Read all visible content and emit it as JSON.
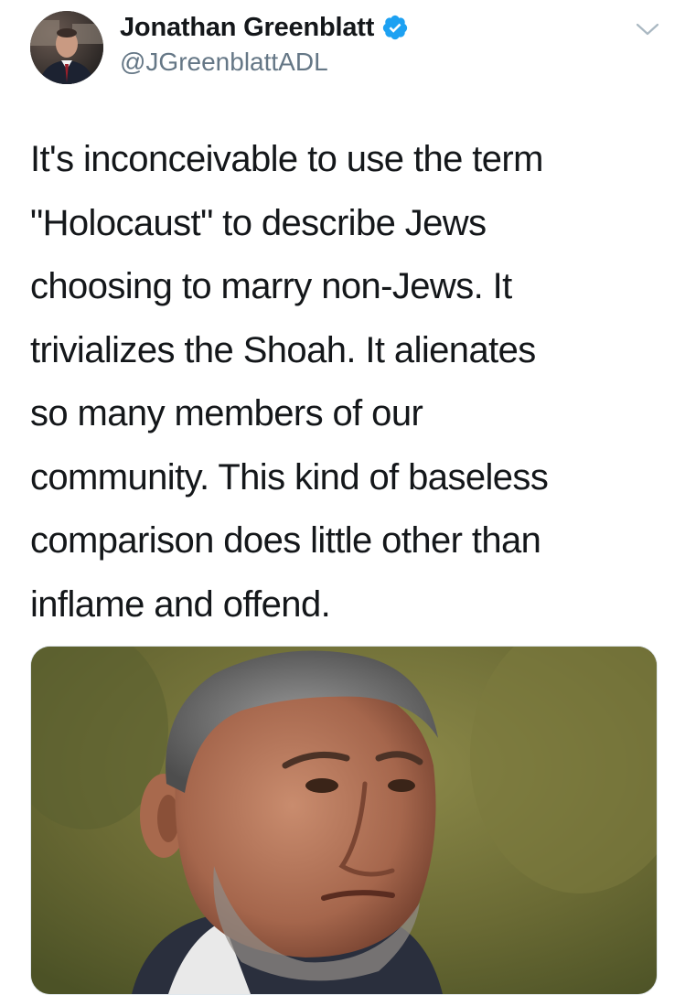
{
  "tweet": {
    "author": {
      "display_name": "Jonathan Greenblatt",
      "handle": "@JGreenblattADL",
      "verified": true,
      "avatar_icon": "user-avatar-photo"
    },
    "menu_icon": "chevron-down-icon",
    "text": "It's inconceivable to use the term\n\"Holocaust\" to describe Jews\nchoosing to marry non-Jews. It\ntrivializes the Shoah. It alienates\nso many members of our\ncommunity. This kind of baseless\ncomparison does little other than\ninflame and offend.",
    "media": {
      "type": "photo",
      "description_icon": "man-portrait-photo"
    }
  },
  "colors": {
    "verified_blue": "#1da1f2",
    "handle_gray": "#657786",
    "text_dark": "#14171a",
    "chevron_gray": "#aab8c2"
  }
}
